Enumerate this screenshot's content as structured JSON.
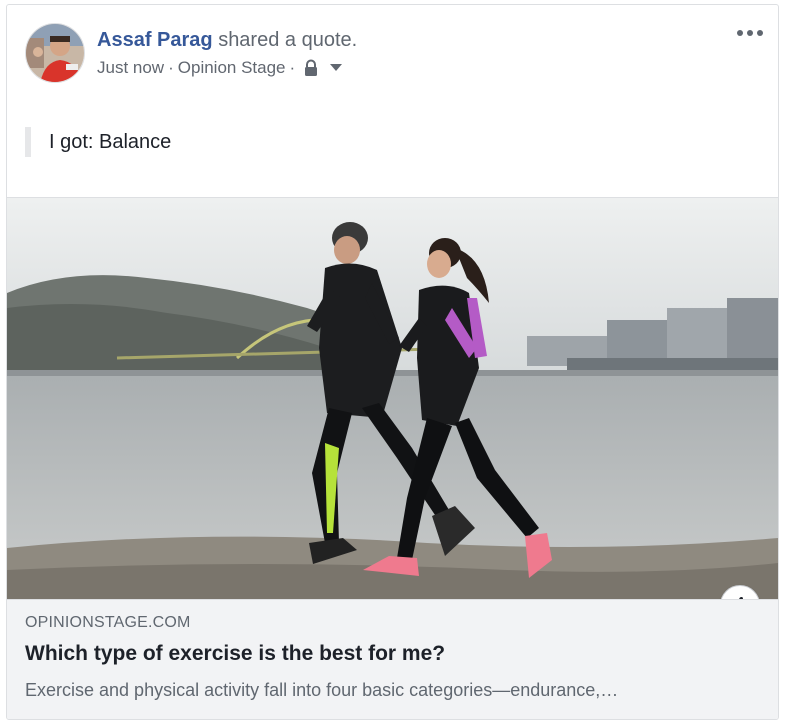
{
  "post": {
    "author": "Assaf Parag",
    "action": "shared a quote.",
    "timestamp": "Just now",
    "app": "Opinion Stage",
    "separator": "·",
    "privacy_icon": "lock-icon",
    "more_icon": "more-options-icon"
  },
  "quote": {
    "text": "I got: Balance"
  },
  "link_card": {
    "image_description": "two-runners-photo",
    "info_label": "i",
    "domain": "OPINIONSTAGE.COM",
    "title": "Which type of exercise is the best for me?",
    "description": "Exercise and physical activity fall into four basic categories—endurance,…"
  },
  "colors": {
    "link_blue": "#365899",
    "meta_gray": "#616770",
    "card_bg": "#f2f3f5",
    "border": "#dddfe2"
  }
}
